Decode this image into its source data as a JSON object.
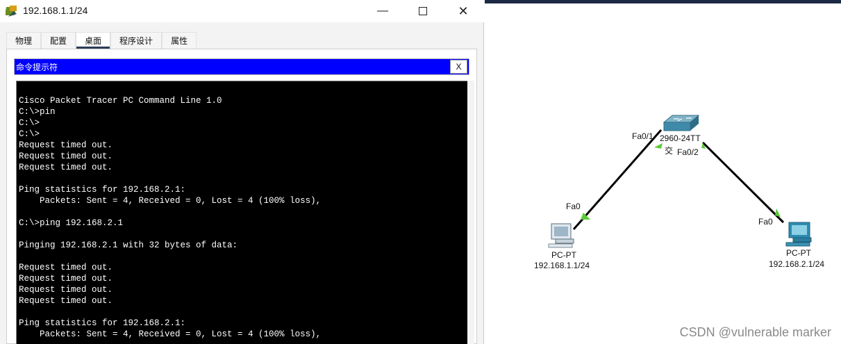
{
  "window": {
    "title": "192.168.1.1/24",
    "tabs": [
      {
        "label": "物理",
        "active": false
      },
      {
        "label": "配置",
        "active": false
      },
      {
        "label": "桌面",
        "active": true
      },
      {
        "label": "程序设计",
        "active": false
      },
      {
        "label": "属性",
        "active": false
      }
    ]
  },
  "cmd": {
    "title": "命令提示符",
    "close_label": "X",
    "lines": [
      "Cisco Packet Tracer PC Command Line 1.0",
      "C:\\>pin",
      "C:\\>",
      "C:\\>",
      "Request timed out.",
      "Request timed out.",
      "Request timed out.",
      "",
      "Ping statistics for 192.168.2.1:",
      "    Packets: Sent = 4, Received = 0, Lost = 4 (100% loss),",
      "",
      "C:\\>ping 192.168.2.1",
      "",
      "Pinging 192.168.2.1 with 32 bytes of data:",
      "",
      "Request timed out.",
      "Request timed out.",
      "Request timed out.",
      "Request timed out.",
      "",
      "Ping statistics for 192.168.2.1:",
      "    Packets: Sent = 4, Received = 0, Lost = 4 (100% loss),"
    ]
  },
  "topology": {
    "switch": {
      "model": "2960-24TT",
      "label_extra": "交",
      "port_left": "Fa0/1",
      "port_right": "Fa0/2"
    },
    "pc1": {
      "type": "PC-PT",
      "ip": "192.168.1.1/24",
      "port": "Fa0"
    },
    "pc2": {
      "type": "PC-PT",
      "ip": "192.168.2.1/24",
      "port": "Fa0"
    },
    "link_color": "#000000",
    "port_indicator_color": "#5ccb3a"
  },
  "watermark": "CSDN @vulnerable marker"
}
